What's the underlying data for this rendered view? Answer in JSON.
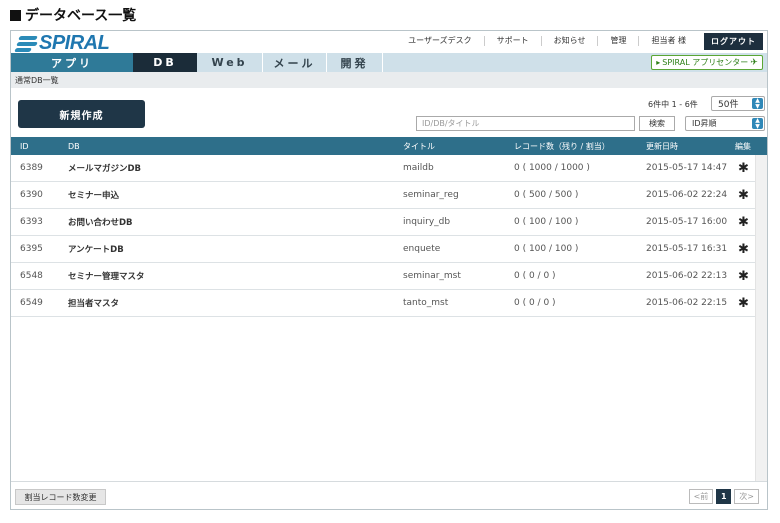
{
  "page_heading": "データベース一覧",
  "logo": {
    "text": "SPIRAL"
  },
  "top_links": [
    "ユーザーズデスク",
    "サポート",
    "お知らせ",
    "管理",
    "担当者 様"
  ],
  "logout_label": "ログアウト",
  "nav_tabs": [
    "アプリ",
    "DB",
    "Web",
    "メール",
    "開発"
  ],
  "app_center_label": "SPIRAL アプリセンター",
  "breadcrumb": "通常DB一覧",
  "new_button_label": "新規作成",
  "result_count": "6件中 1 - 6件",
  "per_page": {
    "selected": "50件"
  },
  "search": {
    "placeholder": "ID/DB/タイトル",
    "button_label": "検索"
  },
  "sort": {
    "selected": "ID昇順"
  },
  "table": {
    "headers": {
      "id": "ID",
      "db": "DB",
      "title": "タイトル",
      "records": "レコード数（残り / 割当）",
      "updated": "更新日時",
      "edit": "編集"
    },
    "rows": [
      {
        "id": "6389",
        "name": "メールマガジンDB",
        "title": "maildb",
        "records": "0 ( 1000 / 1000 )",
        "updated": "2015-05-17 14:47"
      },
      {
        "id": "6390",
        "name": "セミナー申込",
        "title": "seminar_reg",
        "records": "0 ( 500 / 500 )",
        "updated": "2015-06-02 22:24"
      },
      {
        "id": "6393",
        "name": "お問い合わせDB",
        "title": "inquiry_db",
        "records": "0 ( 100 / 100 )",
        "updated": "2015-05-17 16:00"
      },
      {
        "id": "6395",
        "name": "アンケートDB",
        "title": "enquete",
        "records": "0 ( 100 / 100 )",
        "updated": "2015-05-17 16:31"
      },
      {
        "id": "6548",
        "name": "セミナー管理マスタ",
        "title": "seminar_mst",
        "records": "0 ( 0 / 0 )",
        "updated": "2015-06-02 22:13"
      },
      {
        "id": "6549",
        "name": "担当者マスタ",
        "title": "tanto_mst",
        "records": "0 ( 0 / 0 )",
        "updated": "2015-06-02 22:15"
      }
    ]
  },
  "footer": {
    "quota_button_label": "割当レコード数変更",
    "pager": {
      "prev": "<前",
      "current": "1",
      "next": "次>"
    }
  },
  "colors": {
    "header_bar": "#2e6f8a",
    "dark_navy": "#1f3647",
    "nav_bg": "#cfe0e9",
    "accent_green": "#5aa634"
  }
}
